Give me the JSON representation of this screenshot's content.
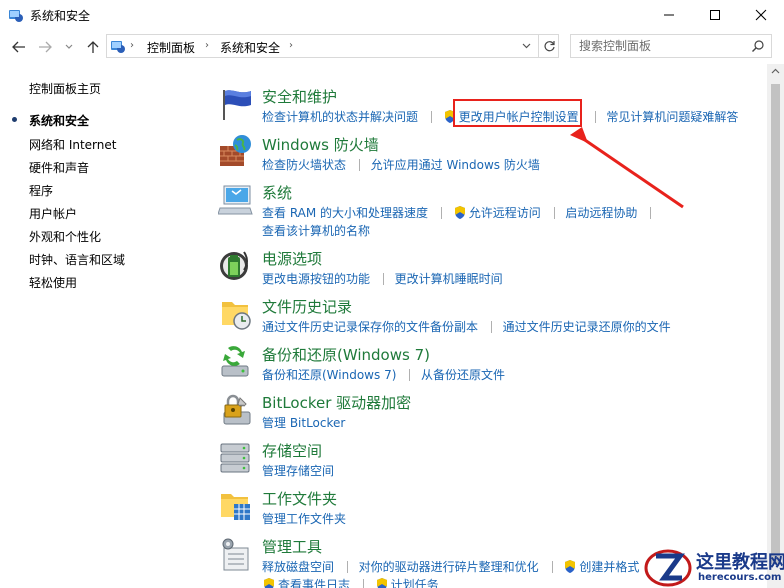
{
  "window": {
    "title": "系统和安全",
    "minimize_icon": "minimize-icon",
    "maximize_icon": "maximize-icon",
    "close_icon": "close-icon"
  },
  "nav": {
    "breadcrumbs": [
      "控制面板",
      "系统和安全"
    ],
    "search_placeholder": "搜索控制面板"
  },
  "sidebar": {
    "items": [
      {
        "label": "控制面板主页",
        "active": false
      },
      {
        "label": "系统和安全",
        "active": true
      },
      {
        "label": "网络和 Internet",
        "active": false
      },
      {
        "label": "硬件和声音",
        "active": false
      },
      {
        "label": "程序",
        "active": false
      },
      {
        "label": "用户帐户",
        "active": false
      },
      {
        "label": "外观和个性化",
        "active": false
      },
      {
        "label": "时钟、语言和区域",
        "active": false
      },
      {
        "label": "轻松使用",
        "active": false
      }
    ]
  },
  "categories": [
    {
      "title": "安全和维护",
      "icon": "flag-icon",
      "links": [
        "检查计算机的状态并解决问题",
        "更改用户帐户控制设置",
        "常见计算机问题疑难解答"
      ]
    },
    {
      "title": "Windows 防火墙",
      "icon": "firewall-icon",
      "links": [
        "检查防火墙状态",
        "允许应用通过 Windows 防火墙"
      ]
    },
    {
      "title": "系统",
      "icon": "computer-icon",
      "links": [
        "查看 RAM 的大小和处理器速度",
        "允许远程访问",
        "启动远程协助"
      ],
      "links2": [
        "查看该计算机的名称"
      ]
    },
    {
      "title": "电源选项",
      "icon": "battery-icon",
      "links": [
        "更改电源按钮的功能",
        "更改计算机睡眠时间"
      ]
    },
    {
      "title": "文件历史记录",
      "icon": "file-history-icon",
      "links": [
        "通过文件历史记录保存你的文件备份副本",
        "通过文件历史记录还原你的文件"
      ]
    },
    {
      "title": "备份和还原(Windows 7)",
      "icon": "backup-icon",
      "links": [
        "备份和还原(Windows 7)",
        "从备份还原文件"
      ]
    },
    {
      "title": "BitLocker 驱动器加密",
      "icon": "bitlocker-icon",
      "links": [
        "管理 BitLocker"
      ]
    },
    {
      "title": "存储空间",
      "icon": "storage-icon",
      "links": [
        "管理存储空间"
      ]
    },
    {
      "title": "工作文件夹",
      "icon": "work-folders-icon",
      "links": [
        "管理工作文件夹"
      ]
    },
    {
      "title": "管理工具",
      "icon": "admin-tools-icon",
      "links": [
        "释放磁盘空间",
        "对你的驱动器进行碎片整理和优化",
        "创建并格式"
      ],
      "links2": [
        "查看事件日志",
        "计划任务"
      ]
    }
  ],
  "watermark": {
    "title": "这里教程网",
    "url": "herecours.com"
  },
  "colors": {
    "category_title": "#1f7a3a",
    "link": "#1a66b3",
    "highlight_box": "#e8221c"
  }
}
